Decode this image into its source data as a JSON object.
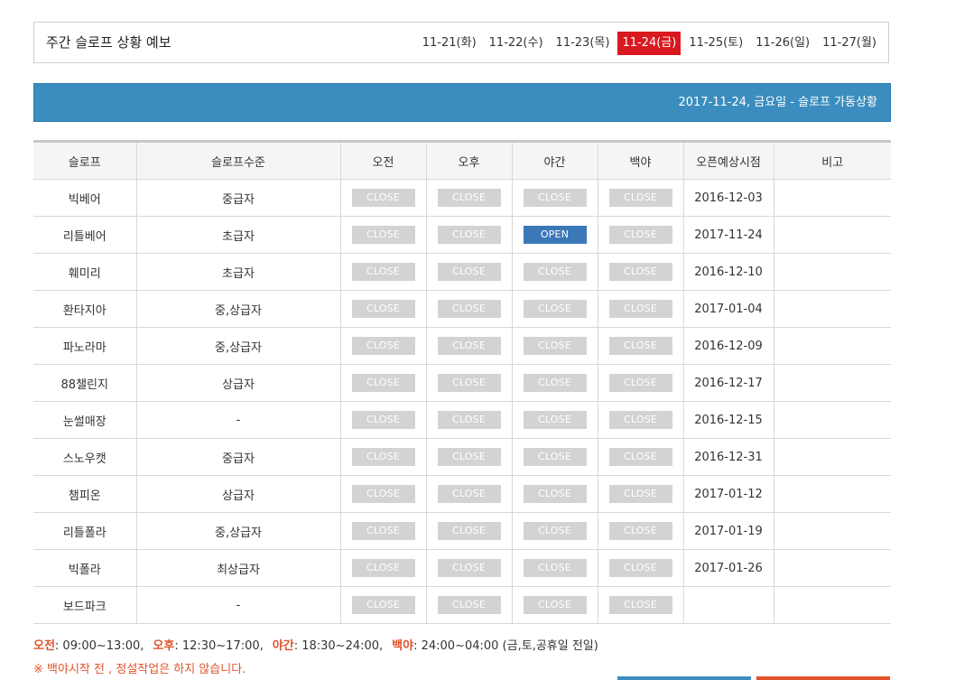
{
  "week": {
    "title": "주간 슬로프 상황 예보",
    "dates": [
      "11-21(화)",
      "11-22(수)",
      "11-23(목)",
      "11-24(금)",
      "11-25(토)",
      "11-26(일)",
      "11-27(월)"
    ],
    "active_index": 3
  },
  "banner": {
    "text": "2017-11-24, 금요일  -  슬로프 가동상황"
  },
  "table": {
    "headers": [
      "슬로프",
      "슬로프수준",
      "오전",
      "오후",
      "야간",
      "백야",
      "오픈예상시점",
      "비고"
    ],
    "rows": [
      {
        "name": "빅베어",
        "level": "중급자",
        "am": "CLOSE",
        "pm": "CLOSE",
        "night": "CLOSE",
        "late": "CLOSE",
        "open_date": "2016-12-03",
        "note": ""
      },
      {
        "name": "리틀베어",
        "level": "초급자",
        "am": "CLOSE",
        "pm": "CLOSE",
        "night": "OPEN",
        "late": "CLOSE",
        "open_date": "2017-11-24",
        "note": ""
      },
      {
        "name": "훼미리",
        "level": "초급자",
        "am": "CLOSE",
        "pm": "CLOSE",
        "night": "CLOSE",
        "late": "CLOSE",
        "open_date": "2016-12-10",
        "note": ""
      },
      {
        "name": "환타지아",
        "level": "중,상급자",
        "am": "CLOSE",
        "pm": "CLOSE",
        "night": "CLOSE",
        "late": "CLOSE",
        "open_date": "2017-01-04",
        "note": ""
      },
      {
        "name": "파노라마",
        "level": "중,상급자",
        "am": "CLOSE",
        "pm": "CLOSE",
        "night": "CLOSE",
        "late": "CLOSE",
        "open_date": "2016-12-09",
        "note": ""
      },
      {
        "name": "88챌린지",
        "level": "상급자",
        "am": "CLOSE",
        "pm": "CLOSE",
        "night": "CLOSE",
        "late": "CLOSE",
        "open_date": "2016-12-17",
        "note": ""
      },
      {
        "name": "눈썰매장",
        "level": "-",
        "am": "CLOSE",
        "pm": "CLOSE",
        "night": "CLOSE",
        "late": "CLOSE",
        "open_date": "2016-12-15",
        "note": ""
      },
      {
        "name": "스노우캣",
        "level": "중급자",
        "am": "CLOSE",
        "pm": "CLOSE",
        "night": "CLOSE",
        "late": "CLOSE",
        "open_date": "2016-12-31",
        "note": ""
      },
      {
        "name": "챔피온",
        "level": "상급자",
        "am": "CLOSE",
        "pm": "CLOSE",
        "night": "CLOSE",
        "late": "CLOSE",
        "open_date": "2017-01-12",
        "note": ""
      },
      {
        "name": "리틀폴라",
        "level": "중,상급자",
        "am": "CLOSE",
        "pm": "CLOSE",
        "night": "CLOSE",
        "late": "CLOSE",
        "open_date": "2017-01-19",
        "note": ""
      },
      {
        "name": "빅폴라",
        "level": "최상급자",
        "am": "CLOSE",
        "pm": "CLOSE",
        "night": "CLOSE",
        "late": "CLOSE",
        "open_date": "2017-01-26",
        "note": ""
      },
      {
        "name": "보드파크",
        "level": "-",
        "am": "CLOSE",
        "pm": "CLOSE",
        "night": "CLOSE",
        "late": "CLOSE",
        "open_date": "",
        "note": ""
      }
    ]
  },
  "legend": {
    "items": [
      {
        "key": "오전",
        "value": ": 09:00~13:00,"
      },
      {
        "key": "오후",
        "value": ": 12:30~17:00,"
      },
      {
        "key": "야간",
        "value": ": 18:30~24:00,"
      },
      {
        "key": "백야",
        "value": ": 24:00~04:00 (금,토,공휴일 전일)"
      }
    ]
  },
  "notice": "※ 백야시작 전 , 정설작업은 하지 않습니다.",
  "colors": {
    "banner": "#3b8dbf",
    "active_tab": "#d9181f",
    "open": "#3c78b8",
    "close": "#d3d3d3",
    "accent": "#e0532a"
  }
}
